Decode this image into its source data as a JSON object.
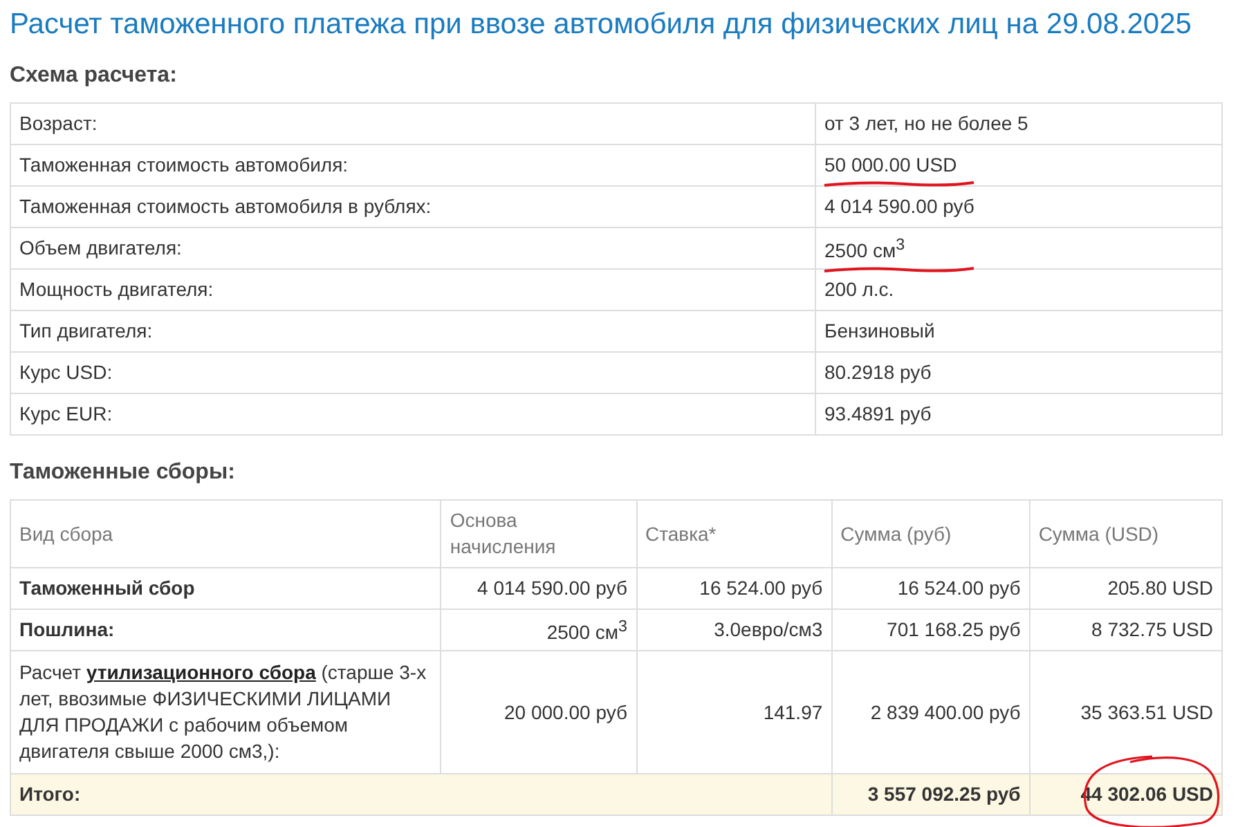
{
  "title": "Расчет таможенного платежа при ввозе автомобиля для физических лиц на 29.08.2025",
  "scheme": {
    "heading": "Схема расчета:",
    "rows": [
      {
        "label": "Возраст:",
        "value": "от 3 лет, но не более 5",
        "underlined": false
      },
      {
        "label": "Таможенная стоимость автомобиля:",
        "value": "50 000.00 USD",
        "underlined": true
      },
      {
        "label": "Таможенная стоимость автомобиля в рублях:",
        "value": "4 014 590.00 руб",
        "underlined": false
      },
      {
        "label": "Объем двигателя:",
        "value": "2500 см$^{3}$",
        "underlined": true
      },
      {
        "label": "Мощность двигателя:",
        "value": "200 л.с.",
        "underlined": false
      },
      {
        "label": "Тип двигателя:",
        "value": "Бензиновый",
        "underlined": false
      },
      {
        "label": "Курс USD:",
        "value": "80.2918 руб",
        "underlined": false
      },
      {
        "label": "Курс EUR:",
        "value": "93.4891 руб",
        "underlined": false
      }
    ]
  },
  "fees": {
    "heading": "Таможенные сборы:",
    "columns": [
      "Вид сбора",
      "Основа начисления",
      "Ставка*",
      "Сумма (руб)",
      "Сумма (USD)"
    ],
    "rows": [
      {
        "kind": "plain",
        "name": "Таможенный сбор",
        "base": "4 014 590.00 руб",
        "rate": "16 524.00 руб",
        "rub": "16 524.00 руб",
        "usd": "205.80 USD"
      },
      {
        "kind": "plain",
        "name": "Пошлина:",
        "base": "2500 см$^{3}$",
        "rate": "3.0евро/см3",
        "rub": "701 168.25 руб",
        "usd": "8 732.75 USD"
      },
      {
        "kind": "link",
        "name_before": "Расчет ",
        "link": "утилизационного сбора",
        "name_after": " (старше 3-х лет, ввозимые ФИЗИЧЕСКИМИ ЛИЦАМИ ДЛЯ ПРОДАЖИ с рабочим объемом двигателя свыше 2000 см3,):",
        "base": "20 000.00 руб",
        "rate": "141.97",
        "rub": "2 839 400.00 руб",
        "usd": "35 363.51 USD"
      }
    ],
    "total": {
      "label": "Итого:",
      "rub": "3 557 092.25 руб",
      "usd": "44 302.06 USD",
      "circled": true
    }
  }
}
